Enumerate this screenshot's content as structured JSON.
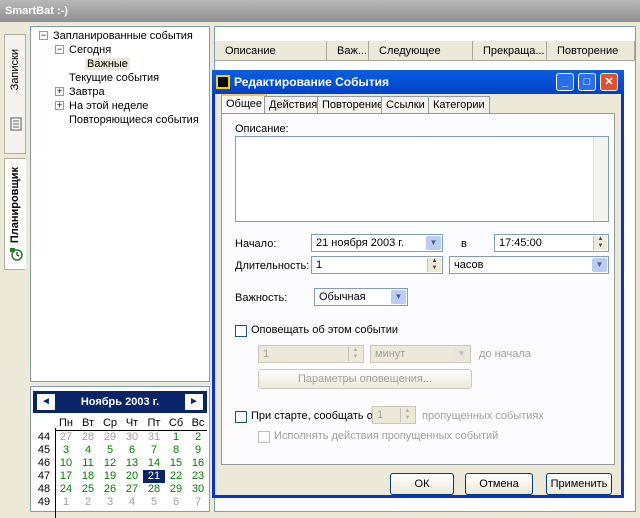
{
  "app": {
    "title": "SmartBat :-)"
  },
  "vtabs": {
    "notes": "Записки",
    "scheduler": "Планировщик"
  },
  "tree": {
    "items": [
      {
        "label": "Запланированные события",
        "expander": "−"
      },
      {
        "label": "Сегодня",
        "expander": "−"
      },
      {
        "label": "Важные",
        "expander": ""
      },
      {
        "label": "Текущие события",
        "expander": ""
      },
      {
        "label": "Завтра",
        "expander": "+"
      },
      {
        "label": "На этой неделе",
        "expander": "+"
      },
      {
        "label": "Повторяющиеся события",
        "expander": ""
      }
    ]
  },
  "calendar": {
    "title": "Ноябрь 2003 г.",
    "prev": "◄",
    "next": "►",
    "weekdays": [
      "Пн",
      "Вт",
      "Ср",
      "Чт",
      "Пт",
      "Сб",
      "Вс"
    ],
    "weeks": [
      {
        "num": "44",
        "days": [
          "27",
          "28",
          "29",
          "30",
          "31",
          "1",
          "2"
        ]
      },
      {
        "num": "45",
        "days": [
          "3",
          "4",
          "5",
          "6",
          "7",
          "8",
          "9"
        ]
      },
      {
        "num": "46",
        "days": [
          "10",
          "11",
          "12",
          "13",
          "14",
          "15",
          "16"
        ]
      },
      {
        "num": "47",
        "days": [
          "17",
          "18",
          "19",
          "20",
          "21",
          "22",
          "23"
        ]
      },
      {
        "num": "48",
        "days": [
          "24",
          "25",
          "26",
          "27",
          "28",
          "29",
          "30"
        ]
      },
      {
        "num": "49",
        "days": [
          "1",
          "2",
          "3",
          "4",
          "5",
          "6",
          "7"
        ]
      }
    ]
  },
  "grid": {
    "columns": [
      "Описание",
      "Важ...",
      "Следующее",
      "Прекраща...",
      "Повторение"
    ]
  },
  "dialog": {
    "title": "Редактирование События",
    "tabs": [
      "Общее",
      "Действия",
      "Повторение",
      "Ссылки",
      "Категории"
    ],
    "description_label": "Описание:",
    "start_label": "Начало:",
    "start_date": "21   ноября   2003 г.",
    "at_label": "в",
    "start_time": "17:45:00",
    "duration_label": "Длительность:",
    "duration_value": "1",
    "duration_unit": "часов",
    "importance_label": "Важность:",
    "importance_value": "Обычная",
    "notify_label": "Оповещать об этом событии",
    "notify_value": "1",
    "notify_unit": "минут",
    "notify_suffix": "до начала",
    "notify_params": "Параметры оповещения...",
    "startup_label": "При старте, сообщать о",
    "startup_value": "1",
    "startup_suffix": "пропущенных событиях",
    "run_missed_label": "Исполнять действия пропущенных событий",
    "ok": "ОК",
    "cancel": "Отмена",
    "apply": "Применить"
  }
}
